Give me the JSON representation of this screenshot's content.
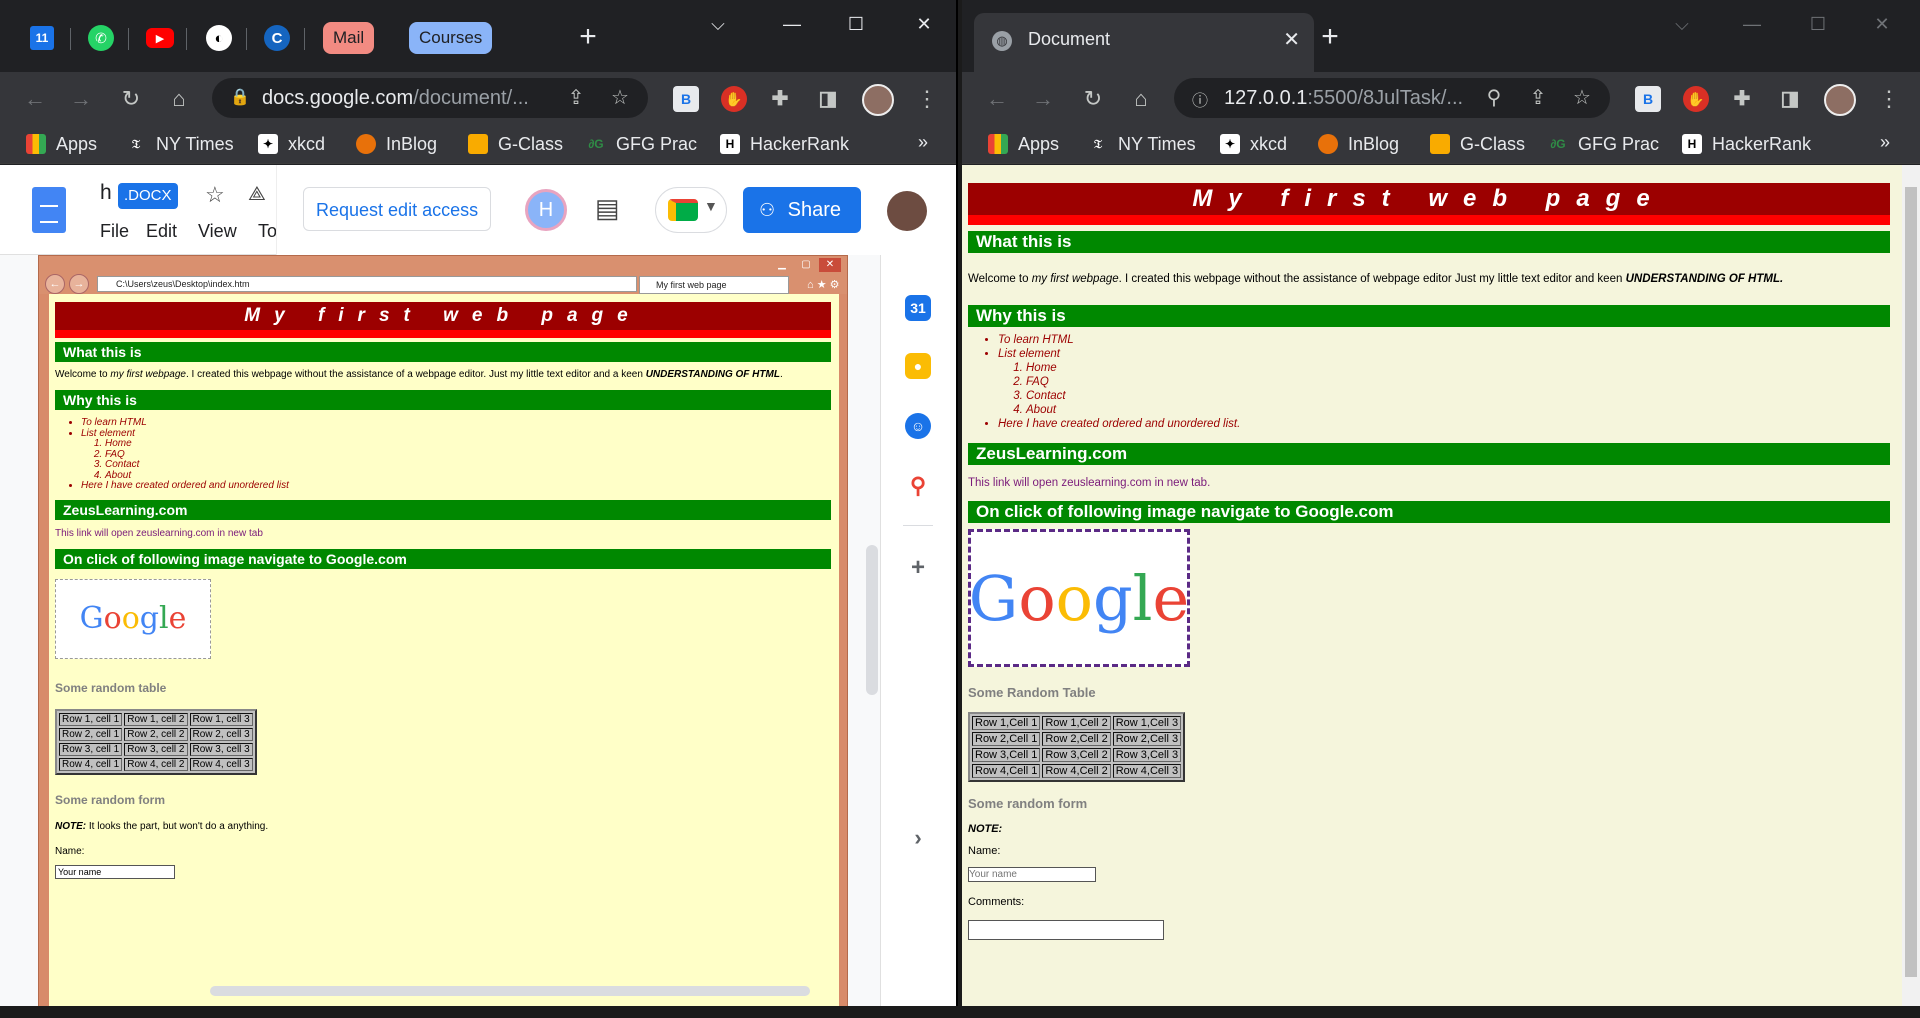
{
  "left_window": {
    "tab_groups": [
      "Mail",
      "Courses"
    ],
    "pinned_tabs": [
      "calendar-icon",
      "whatsapp-icon",
      "youtube-icon",
      "github-icon",
      "c-icon"
    ],
    "pinned_calendar_day": "11",
    "url_host": "docs.google.com",
    "url_path": "/document/...",
    "bookmarks": [
      "Apps",
      "NY Times",
      "xkcd",
      "InBlog",
      "G-Class",
      "GFG Prac",
      "HackerRank"
    ],
    "bookmark_more": "»",
    "docs": {
      "title_initial": "h",
      "docx_badge": ".DOCX",
      "menu": [
        "File",
        "Edit",
        "View",
        "To"
      ],
      "request_edit": "Request edit access",
      "avatar_letter": "H",
      "share": "Share",
      "side_calendar_day": "31"
    },
    "ie": {
      "address": "C:\\Users\\zeus\\Desktop\\index.htm",
      "tab_title": "My first web page",
      "page": {
        "title": "My first web page",
        "h_what": "What this is",
        "welcome_a": "Welcome to ",
        "welcome_em": "my first webpage",
        "welcome_b": ". I created this webpage without the assistance of a webpage editor. Just my little text editor and a keen ",
        "welcome_strong": "UNDERSTANDING OF HTML",
        "welcome_end": ".",
        "h_why": "Why this is",
        "list": [
          "To learn HTML",
          "List element",
          "Here I have created ordered and unordered list"
        ],
        "ordered": [
          "Home",
          "FAQ",
          "Contact",
          "About"
        ],
        "h_zeus": "ZeusLearning.com",
        "link_text": "This link will open zeuslearning.com in new tab",
        "h_google": "On click of following image navigate to Google.com",
        "table_heading": "Some random table",
        "table": [
          [
            "Row 1, cell 1",
            "Row 1, cell 2",
            "Row 1, cell 3"
          ],
          [
            "Row 2, cell 1",
            "Row 2, cell 2",
            "Row 2, cell 3"
          ],
          [
            "Row 3, cell 1",
            "Row 3, cell 2",
            "Row 3, cell 3"
          ],
          [
            "Row 4, cell 1",
            "Row 4, cell 2",
            "Row 4, cell 3"
          ]
        ],
        "form_heading": "Some random form",
        "note_label": "NOTE:",
        "note_text": " It looks the part, but won't do a anything.",
        "name_label": "Name:",
        "name_placeholder": "Your name"
      }
    }
  },
  "right_window": {
    "tab_title": "Document",
    "url_host": "127.0.0.1",
    "url_path": ":5500/8JulTask/...",
    "bookmarks": [
      "Apps",
      "NY Times",
      "xkcd",
      "InBlog",
      "G-Class",
      "GFG Prac",
      "HackerRank"
    ],
    "bookmark_more": "»",
    "page": {
      "title": "My first web page",
      "h_what": "What this is",
      "welcome_a": "Welcome to ",
      "welcome_em": "my first webpage",
      "welcome_b": ". I created this webpage without the assistance of webpage editor Just my little text editor and keen ",
      "welcome_strong": "UNDERSTANDING OF HTML.",
      "h_why": "Why this is",
      "list": [
        "To learn HTML",
        "List element",
        "Here I have created ordered and unordered list."
      ],
      "ordered": [
        "Home",
        "FAQ",
        "Contact",
        "About"
      ],
      "h_zeus": "ZeusLearning.com",
      "link_text": "This link will open zeuslearning.com in new tab.",
      "h_google": "On click of following image navigate to Google.com",
      "table_heading": "Some Random Table",
      "table": [
        [
          "Row 1,Cell 1",
          "Row 1,Cell 2",
          "Row 1,Cell 3"
        ],
        [
          "Row 2,Cell 1",
          "Row 2,Cell 2",
          "Row 2,Cell 3"
        ],
        [
          "Row 3,Cell 1",
          "Row 3,Cell 2",
          "Row 3,Cell 3"
        ],
        [
          "Row 4,Cell 1",
          "Row 4,Cell 2",
          "Row 4,Cell 3"
        ]
      ],
      "form_heading": "Some random form",
      "note_label": "NOTE:",
      "name_label": "Name:",
      "name_placeholder": "Your name",
      "comments_label": "Comments:"
    }
  },
  "google_logo": [
    "G",
    "o",
    "o",
    "g",
    "l",
    "e"
  ],
  "colors": {
    "chrome_dark": "#202124",
    "toolbar": "#35363a",
    "heading_green": "#008800",
    "title_red": "#9c0000",
    "ie_page_bg": "#ffffc8",
    "right_page_bg": "#f5f5dc"
  }
}
